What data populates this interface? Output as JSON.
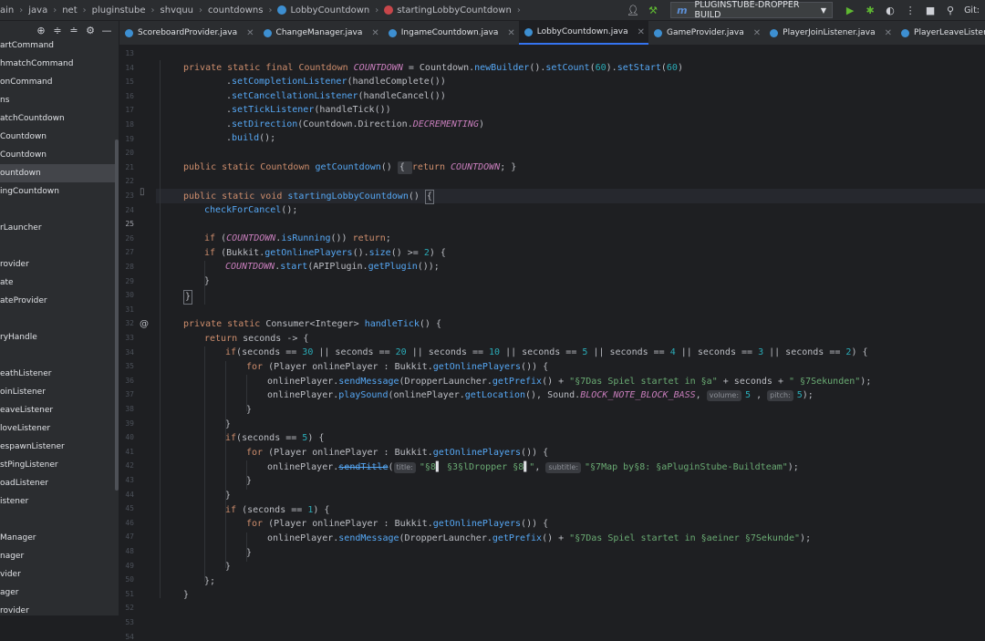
{
  "breadcrumbs": [
    "ain",
    "java",
    "net",
    "pluginstube",
    "shvquu",
    "countdowns",
    "LobbyCountdown",
    "startingLobbyCountdown"
  ],
  "run_config": {
    "label": "PLUGINSTUBE-DROPPER BUILD"
  },
  "git_label": "Git:",
  "project_tree": [
    "artCommand",
    "hmatchCommand",
    "onCommand",
    "ns",
    "atchCountdown",
    "Countdown",
    "Countdown",
    "ountdown",
    "ingCountdown",
    "",
    "rLauncher",
    "",
    "rovider",
    "ate",
    "ateProvider",
    "",
    "ryHandle",
    "",
    "eathListener",
    "oinListener",
    "eaveListener",
    "loveListener",
    "espawnListener",
    "stPingListener",
    "oadListener",
    "istener",
    "",
    "Manager",
    "nager",
    "vider",
    "ager",
    "rovider"
  ],
  "project_selected_index": 7,
  "tabs": [
    {
      "label": "ScoreboardProvider.java",
      "active": false
    },
    {
      "label": "ChangeManager.java",
      "active": false
    },
    {
      "label": "IngameCountdown.java",
      "active": false
    },
    {
      "label": "LobbyCountdown.java",
      "active": true
    },
    {
      "label": "GameProvider.java",
      "active": false
    },
    {
      "label": "PlayerJoinListener.java",
      "active": false
    },
    {
      "label": "PlayerLeaveListener.java",
      "active": false
    }
  ],
  "current_line": 25,
  "line_numbers": [
    "13",
    "14",
    "15",
    "16",
    "17",
    "18",
    "19",
    "20",
    "21",
    "22",
    "23",
    "24",
    "25",
    "26",
    "27",
    "28",
    "29",
    "30",
    "31",
    "32",
    "33",
    "34",
    "35",
    "36",
    "37",
    "38",
    "39",
    "40",
    "41",
    "42",
    "43",
    "44",
    "45",
    "46",
    "47",
    "48",
    "49",
    "50",
    "51",
    "52",
    "53",
    "54"
  ],
  "code": {
    "l14_a": "private static final ",
    "l14_b": "Countdown ",
    "l14_c": "COUNTDOWN",
    "l14_d": " = Countdown.",
    "l14_e": "newBuilder",
    "l14_f": "().",
    "l14_g": "setCount",
    "l14_h": "(",
    "l14_i": "60",
    "l14_j": ").",
    "l14_k": "setStart",
    "l14_l": "(",
    "l14_m": "60",
    "l15_a": ".",
    "l15_b": "setCompletionListener",
    "l15_c": "(handleComplete())",
    "l16_b": "setCancellationListener",
    "l16_c": "(handleCancel())",
    "l17_b": "setTickListener",
    "l17_c": "(handleTick())",
    "l18_b": "setDirection",
    "l18_c": "(Countdown.Direction.",
    "l18_d": "DECREMENTING",
    "l18_e": ")",
    "l19_b": "build",
    "l19_c": "();",
    "l21_a": "public static ",
    "l21_b": "Countdown ",
    "l21_c": "getCountdown",
    "l21_d": "() ",
    "l21_e": "{ ",
    "l21_f": "return ",
    "l21_g": "COUNTDOWN",
    "l21_h": "; }",
    "l25_a": "public static void ",
    "l25_b": "startingLobbyCountdown",
    "l25_c": "() ",
    "l25_d": "{",
    "l26_a": "checkForCancel",
    "l26_b": "();",
    "l28_a": "if ",
    "l28_b": "(",
    "l28_c": "COUNTDOWN",
    "l28_d": ".",
    "l28_e": "isRunning",
    "l28_f": "()) ",
    "l28_g": "return",
    "l28_h": ";",
    "l29_a": "if ",
    "l29_b": "(Bukkit.",
    "l29_c": "getOnlinePlayers",
    "l29_d": "().",
    "l29_e": "size",
    "l29_f": "() >= ",
    "l29_g": "2",
    "l29_h": ") {",
    "l30_a": "COUNTDOWN",
    "l30_b": ".",
    "l30_c": "start",
    "l30_d": "(APIPlugin.",
    "l30_e": "getPlugin",
    "l30_f": "());",
    "close_brace": "}",
    "l34_a": "private static ",
    "l34_b": "Consumer<Integer> ",
    "l34_c": "handleTick",
    "l34_d": "() {",
    "l35_a": "return ",
    "l35_b": "seconds -> {",
    "l36_a": "if",
    "l36_b": "(seconds == ",
    "l36_30": "30",
    "l36_or1": " || seconds == ",
    "l36_20": "20",
    "l36_10": "10",
    "l36_5": "5",
    "l36_4": "4",
    "l36_3": "3",
    "l36_2": "2",
    "l36_end": ") {",
    "l37_a": "for ",
    "l37_b": "(Player onlinePlayer : Bukkit.",
    "l37_c": "getOnlinePlayers",
    "l37_d": "()) {",
    "l38_a": "onlinePlayer.",
    "l38_b": "sendMessage",
    "l38_c": "(DropperLauncher.",
    "l38_d": "getPrefix",
    "l38_e": "() + ",
    "l38_f": "\"§7Das Spiel startet in §a\"",
    "l38_g": " + seconds + ",
    "l38_h": "\" §7Sekunden\"",
    "l38_i": ");",
    "l39_a": "onlinePlayer.",
    "l39_b": "playSound",
    "l39_c": "(onlinePlayer.",
    "l39_d": "getLocation",
    "l39_e": "(), Sound.",
    "l39_f": "BLOCK_NOTE_BLOCK_BASS",
    "l39_g": ", ",
    "hint_volume": "volume:",
    "l39_h": "5",
    "l39_i": " , ",
    "hint_pitch": "pitch:",
    "l39_j": "5",
    "l39_k": ");",
    "l42_a": "if",
    "l42_b": "(seconds == ",
    "l42_c": "5",
    "l42_d": ") {",
    "l44_a": "onlinePlayer.",
    "l44_b": "sendTitle",
    "l44_c": "(",
    "hint_title": "title:",
    "l44_d": "\"§8",
    "l44_e": " §3§lDropper §8",
    "l44_f": "\"",
    "l44_g": ", ",
    "hint_subtitle": "subtitle:",
    "l44_h": "\"§7Map by§8: §aPluginStube-Buildteam\"",
    "l44_i": ");",
    "l47_a": "if ",
    "l47_b": "(seconds == ",
    "l47_c": "1",
    "l47_d": ") {",
    "l49_f": "\"§7Das Spiel startet in §aeiner §7Sekunde\"",
    "l49_i": ");",
    "l52": "};"
  }
}
